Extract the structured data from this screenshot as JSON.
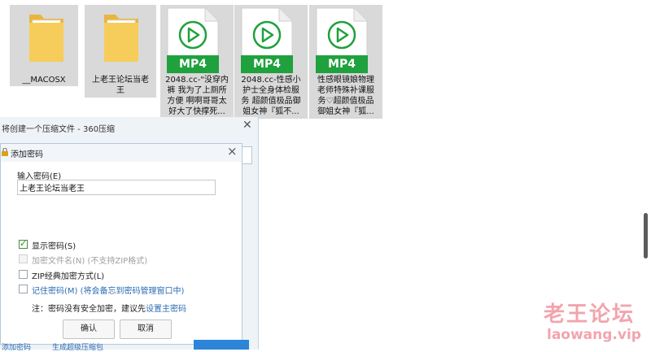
{
  "files": [
    {
      "name": "__MACOSX",
      "type": "folder"
    },
    {
      "name": "上老王论坛当老王",
      "type": "folder"
    },
    {
      "name": "2048.cc-\"没穿内裤 我为了上厕所方便 啊啊哥哥太好大了快撑死...",
      "type": "mp4",
      "badge": "MP4"
    },
    {
      "name": "2048.cc-性感小护士全身体检服务 超颜值极品御姐女神『狐不...",
      "type": "mp4",
      "badge": "MP4"
    },
    {
      "name": "性感眼镜娘物理老师特殊补课服务♡超颜值极品御姐女神『狐...",
      "type": "mp4",
      "badge": "MP4"
    }
  ],
  "file_lines": [
    [
      "__MACOSX"
    ],
    [
      "上老王论坛当老",
      "王"
    ],
    [
      "2048.cc-\"没穿内",
      "裤 我为了上厕所",
      "方便 啊啊哥哥太",
      "好大了快撑死..."
    ],
    [
      "2048.cc-性感小",
      "护士全身体检服",
      "务 超颜值极品御",
      "姐女神『狐不..."
    ],
    [
      "性感眼镜娘物理",
      "老师特殊补课服",
      "务♡超颜值极品",
      "御姐女神『狐..."
    ]
  ],
  "back_window": {
    "title": "将创建一个压缩文件 - 360压缩",
    "bottom_left": "添加密码",
    "bottom_mid": "生成超级压缩包"
  },
  "dialog": {
    "title": "添加密码",
    "password_label": "输入密码(E)",
    "password_value": "上老王论坛当老王",
    "options": [
      {
        "label": "显示密码(S)",
        "checked": true,
        "enabled": true
      },
      {
        "label": "加密文件名(N) (不支持ZIP格式)",
        "checked": false,
        "enabled": false
      },
      {
        "label": "ZIP经典加密方式(L)",
        "checked": false,
        "enabled": true
      },
      {
        "label": "记住密码(M) (将会备忘到密码管理窗口中)",
        "checked": false,
        "enabled": true
      }
    ],
    "note_prefix": "注：密码没有安全加密，建议先",
    "note_link": "设置主密码",
    "ok": "确认",
    "cancel": "取消"
  },
  "watermark": {
    "line1": "老王论坛",
    "line2": "laowang.vip"
  },
  "colors": {
    "mp4_green": "#1fa13d",
    "folder_yellow": "#f5c64f",
    "link_blue": "#2a6cb3"
  }
}
